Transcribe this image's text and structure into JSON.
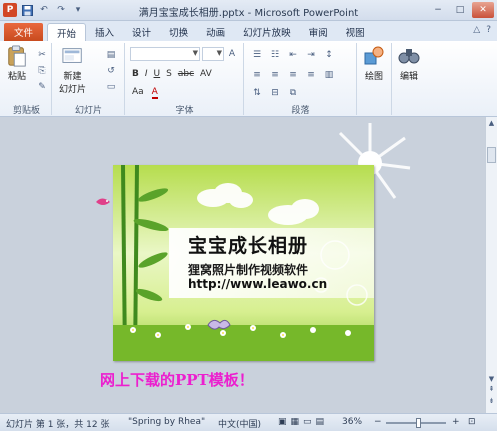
{
  "window": {
    "title": "满月宝宝成长相册.pptx - Microsoft PowerPoint",
    "app_icon": "P",
    "minimize": "−",
    "maximize": "□",
    "close": "✕"
  },
  "quick_access": {
    "save_icon": "save-icon",
    "undo_icon": "undo-icon",
    "redo_icon": "redo-icon",
    "customize_icon": "customize-icon"
  },
  "tabs": {
    "file": "文件",
    "items": [
      "开始",
      "插入",
      "设计",
      "切换",
      "动画",
      "幻灯片放映",
      "审阅",
      "视图"
    ],
    "active": "开始"
  },
  "ribbon": {
    "groups": {
      "clipboard": "剪贴板",
      "slides": "幻灯片",
      "font": "字体",
      "paragraph": "段落"
    },
    "paste_label": "粘贴",
    "new_slide_line1": "新建",
    "new_slide_line2": "幻灯片",
    "drawing_label": "绘图",
    "editing_label": "编辑",
    "font_buttons": [
      "B",
      "I",
      "U",
      "S",
      "abc",
      "AV",
      "Aa",
      "A"
    ]
  },
  "slide": {
    "title": "宝宝成长相册",
    "subtitle": "狸窝照片制作视频软件",
    "url": "http://www.leawo.cn"
  },
  "caption": "网上下载的PPT模板！",
  "statusbar": {
    "slide_info": "幻灯片 第 1 张，共 12 张",
    "theme": "\"Spring by Rhea\"",
    "language": "中文(中国)",
    "zoom": "36%",
    "zoom_minus": "−",
    "zoom_plus": "+"
  },
  "colors": {
    "file_tab": "#d24726",
    "caption": "#ec1fcf",
    "slide_green": "#8cc63b"
  }
}
